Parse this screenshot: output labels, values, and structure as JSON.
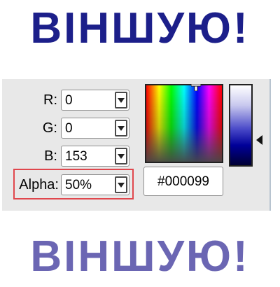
{
  "headline_top": {
    "text": "ВІНШУЮ!",
    "color": "#1c1f8a"
  },
  "headline_bottom": {
    "text": "ВІНШУЮ!",
    "color": "#6b66b3"
  },
  "color_picker": {
    "fields": [
      {
        "label": "R:",
        "value": "0"
      },
      {
        "label": "G:",
        "value": "0"
      },
      {
        "label": "B:",
        "value": "153"
      },
      {
        "label": "Alpha:",
        "value": "50%"
      }
    ],
    "hex_value": "#000099",
    "highlight_color": "#e0474d",
    "selected_color": "#000099"
  }
}
